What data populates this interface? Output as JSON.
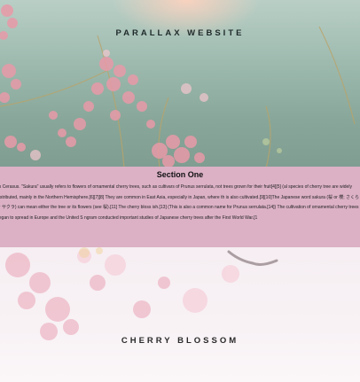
{
  "header": {
    "title": "PARALLAX WEBSITE"
  },
  "section": {
    "heading": "Section One",
    "body": "us Cerasus. \"Sakura\" usually refers to flowers of ornamental cherry trees, such as cultivars of Prunus serrulata, not trees grown for their fruit[4][5] (al species of cherry tree are widely distributed, mainly in the Northern Hemisphere.[6][7][8] They are common in East Asia, especially in Japan, where th is also cultivated.[9][10]The Japanese word sakura (桜 or 櫻; さくら or サクラ) can mean either the tree or its flowers (see 桜).[11] The cherry bloss ish.[13] (This is also a common name for Prunus serrulata.[14]) The cultivation of ornamental cherry trees began to spread in Europe and the United S ngram conducted important studies of Japanese cherry trees after the First World War.[1"
  },
  "footer_banner": {
    "title": "CHERRY BLOSSOM"
  },
  "colors": {
    "section_bg": "#dcb1c6",
    "blossom_pink": "#e89aa8",
    "sky_green": "#9fbbb0"
  }
}
